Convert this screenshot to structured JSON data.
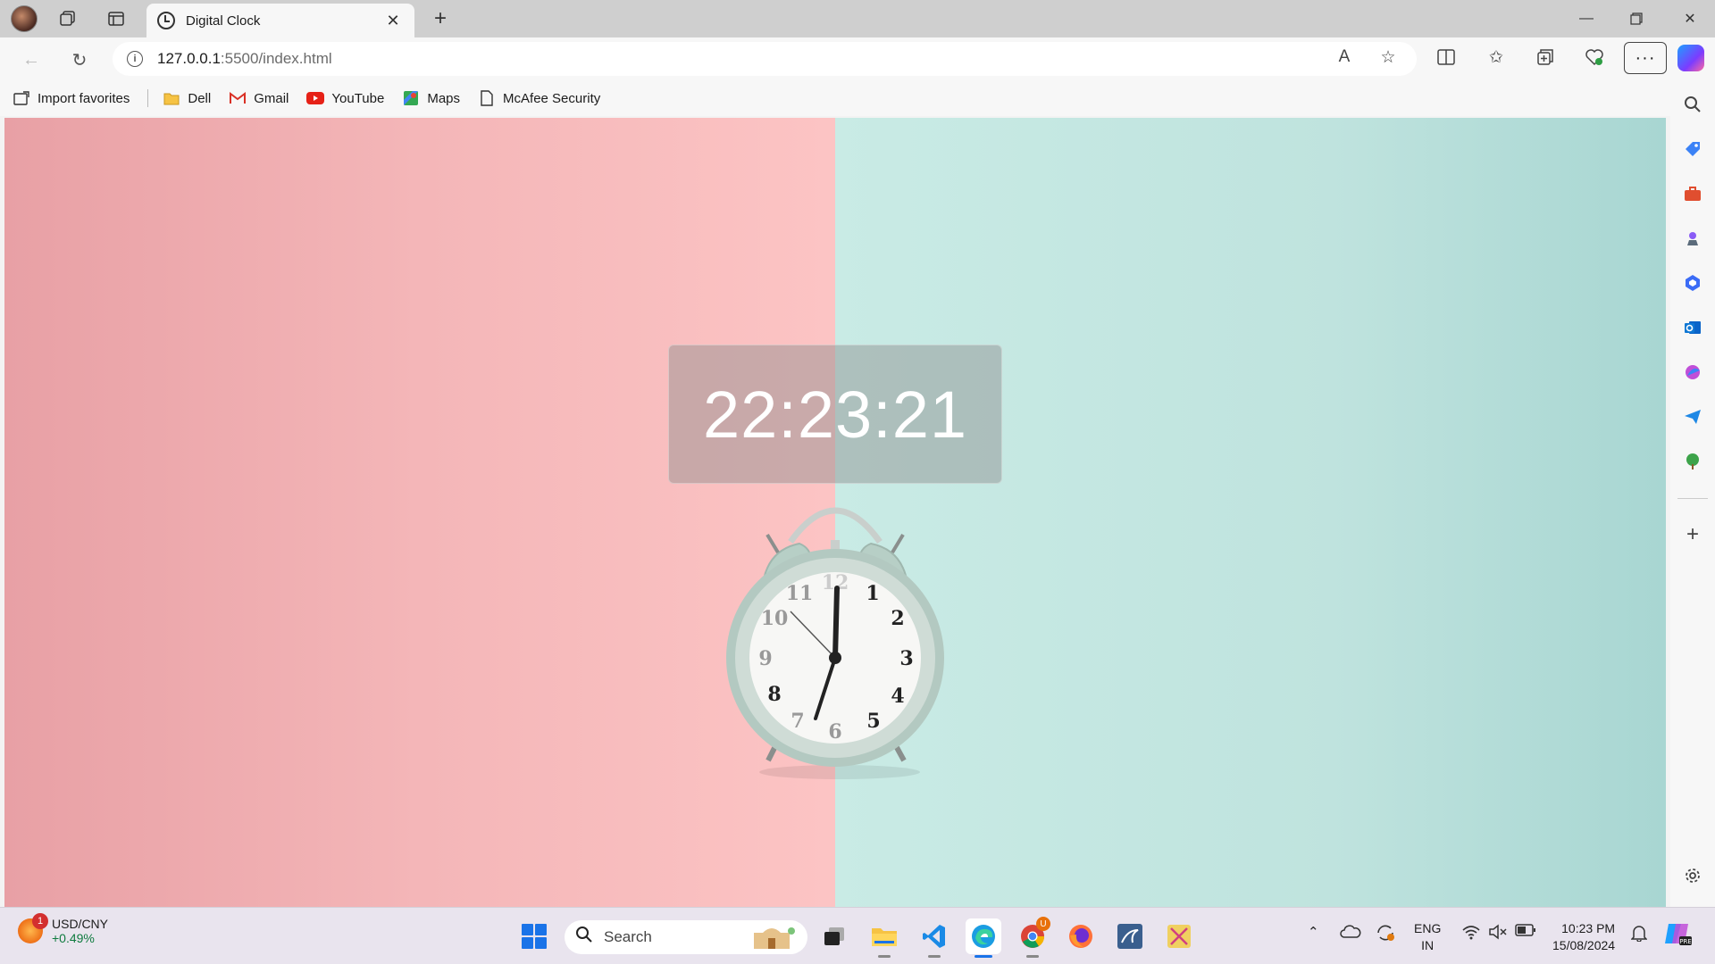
{
  "browser": {
    "tab_title": "Digital Clock",
    "url_host": "127.0.0.1",
    "url_path": ":5500/index.html",
    "favorites": [
      {
        "label": "Import favorites",
        "icon": "import-icon"
      },
      {
        "label": "Dell",
        "icon": "folder-icon"
      },
      {
        "label": "Gmail",
        "icon": "gmail-icon"
      },
      {
        "label": "YouTube",
        "icon": "youtube-icon"
      },
      {
        "label": "Maps",
        "icon": "maps-icon"
      },
      {
        "label": "McAfee Security",
        "icon": "page-icon"
      }
    ]
  },
  "page": {
    "time": "22:23:21",
    "left_color": "#fcc4c4",
    "right_color": "#c9ebe5"
  },
  "taskbar": {
    "widget_badge": "1",
    "widget_title": "USD/CNY",
    "widget_value": "+0.49%",
    "search_placeholder": "Search",
    "lang_line1": "ENG",
    "lang_line2": "IN",
    "clock_time": "10:23 PM",
    "clock_date": "15/08/2024",
    "chrome_badge": "U"
  }
}
